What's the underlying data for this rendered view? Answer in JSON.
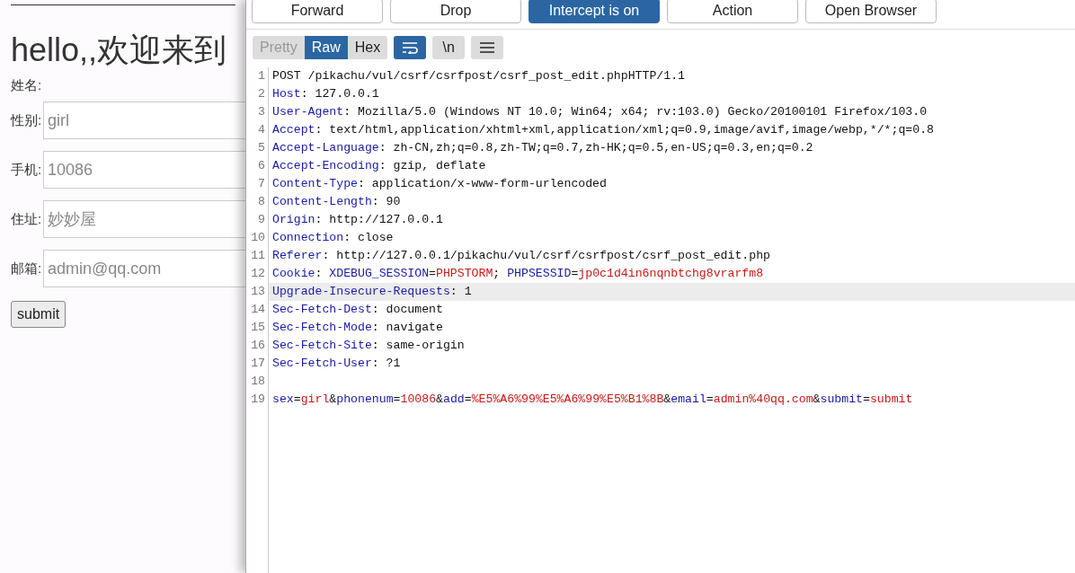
{
  "page": {
    "heading": "hello,,欢迎来到",
    "fields": [
      {
        "label": "姓名:",
        "kind": "text"
      },
      {
        "label": "性别:",
        "kind": "input",
        "placeholder": "girl"
      },
      {
        "label": "手机:",
        "kind": "input",
        "placeholder": "10086"
      },
      {
        "label": "住址:",
        "kind": "input",
        "placeholder": "妙妙屋"
      },
      {
        "label": "邮箱:",
        "kind": "input",
        "placeholder": "admin@qq.com"
      }
    ],
    "submit": "submit"
  },
  "proxy": {
    "actions": [
      {
        "label": "Forward",
        "selected": false
      },
      {
        "label": "Drop",
        "selected": false
      },
      {
        "label": "Intercept is on",
        "selected": true
      },
      {
        "label": "Action",
        "selected": false
      },
      {
        "label": "Open Browser",
        "selected": false
      }
    ],
    "view_tabs": [
      {
        "label": "Pretty",
        "selected": false,
        "disabled": true
      },
      {
        "label": "Raw",
        "selected": true,
        "disabled": false
      },
      {
        "label": "Hex",
        "selected": false,
        "disabled": false
      }
    ],
    "tools": [
      {
        "kind": "wrap",
        "selected": true
      },
      {
        "kind": "newline",
        "label": "\\n",
        "selected": false
      },
      {
        "kind": "menu",
        "selected": false
      }
    ],
    "lines": [
      {
        "number": "1",
        "highlighted": false,
        "parts": [
          {
            "text": "POST /pikachu/vul/csrf/csrfpost/csrf_post_edit.phpHTTP/1.1",
            "kind": "plain"
          }
        ]
      },
      {
        "number": "2",
        "highlighted": false,
        "parts": [
          {
            "text": "Host",
            "kind": "key"
          },
          {
            "text": ": 127.0.0.1",
            "kind": "plain"
          }
        ]
      },
      {
        "number": "3",
        "highlighted": false,
        "parts": [
          {
            "text": "User-Agent",
            "kind": "key"
          },
          {
            "text": ": Mozilla/5.0 (Windows NT 10.0; Win64; x64; rv:103.0) Gecko/20100101 Firefox/103.0",
            "kind": "plain"
          }
        ]
      },
      {
        "number": "4",
        "highlighted": false,
        "parts": [
          {
            "text": "Accept",
            "kind": "key"
          },
          {
            "text": ": text/html,application/xhtml+xml,application/xml;q=0.9,image/avif,image/webp,*/*;q=0.8",
            "kind": "plain"
          }
        ]
      },
      {
        "number": "5",
        "highlighted": false,
        "parts": [
          {
            "text": "Accept-Language",
            "kind": "key"
          },
          {
            "text": ": zh-CN,zh;q=0.8,zh-TW;q=0.7,zh-HK;q=0.5,en-US;q=0.3,en;q=0.2",
            "kind": "plain"
          }
        ]
      },
      {
        "number": "6",
        "highlighted": false,
        "parts": [
          {
            "text": "Accept-Encoding",
            "kind": "key"
          },
          {
            "text": ": gzip, deflate",
            "kind": "plain"
          }
        ]
      },
      {
        "number": "7",
        "highlighted": false,
        "parts": [
          {
            "text": "Content-Type",
            "kind": "key"
          },
          {
            "text": ": application/x-www-form-urlencoded",
            "kind": "plain"
          }
        ]
      },
      {
        "number": "8",
        "highlighted": false,
        "parts": [
          {
            "text": "Content-Length",
            "kind": "key"
          },
          {
            "text": ": 90",
            "kind": "plain"
          }
        ]
      },
      {
        "number": "9",
        "highlighted": false,
        "parts": [
          {
            "text": "Origin",
            "kind": "key"
          },
          {
            "text": ": http://127.0.0.1",
            "kind": "plain"
          }
        ]
      },
      {
        "number": "10",
        "highlighted": false,
        "parts": [
          {
            "text": "Connection",
            "kind": "key"
          },
          {
            "text": ": close",
            "kind": "plain"
          }
        ]
      },
      {
        "number": "11",
        "highlighted": false,
        "parts": [
          {
            "text": "Referer",
            "kind": "key"
          },
          {
            "text": ": http://127.0.0.1/pikachu/vul/csrf/csrfpost/csrf_post_edit.php",
            "kind": "plain"
          }
        ]
      },
      {
        "number": "12",
        "highlighted": false,
        "parts": [
          {
            "text": "Cookie",
            "kind": "key"
          },
          {
            "text": ": ",
            "kind": "plain"
          },
          {
            "text": "XDEBUG_SESSION",
            "kind": "key"
          },
          {
            "text": "=",
            "kind": "plain"
          },
          {
            "text": "PHPSTORM",
            "kind": "value"
          },
          {
            "text": "; ",
            "kind": "plain"
          },
          {
            "text": "PHPSESSID",
            "kind": "key"
          },
          {
            "text": "=",
            "kind": "plain"
          },
          {
            "text": "jp0c1d4in6nqnbtchg8vrarfm8",
            "kind": "value"
          }
        ]
      },
      {
        "number": "13",
        "highlighted": true,
        "parts": [
          {
            "text": "Upgrade-Insecure-Requests",
            "kind": "key"
          },
          {
            "text": ": 1",
            "kind": "plain"
          }
        ]
      },
      {
        "number": "14",
        "highlighted": false,
        "parts": [
          {
            "text": "Sec-Fetch-Dest",
            "kind": "key"
          },
          {
            "text": ": document",
            "kind": "plain"
          }
        ]
      },
      {
        "number": "15",
        "highlighted": false,
        "parts": [
          {
            "text": "Sec-Fetch-Mode",
            "kind": "key"
          },
          {
            "text": ": navigate",
            "kind": "plain"
          }
        ]
      },
      {
        "number": "16",
        "highlighted": false,
        "parts": [
          {
            "text": "Sec-Fetch-Site",
            "kind": "key"
          },
          {
            "text": ": same-origin",
            "kind": "plain"
          }
        ]
      },
      {
        "number": "17",
        "highlighted": false,
        "parts": [
          {
            "text": "Sec-Fetch-User",
            "kind": "key"
          },
          {
            "text": ": ?1",
            "kind": "plain"
          }
        ]
      },
      {
        "number": "18",
        "highlighted": false
      },
      {
        "number": "19",
        "highlighted": false,
        "parts": [
          {
            "text": "sex",
            "kind": "key"
          },
          {
            "text": "=",
            "kind": "plain"
          },
          {
            "text": "girl",
            "kind": "value"
          },
          {
            "text": "&",
            "kind": "plain"
          },
          {
            "text": "phonenum",
            "kind": "key"
          },
          {
            "text": "=",
            "kind": "plain"
          },
          {
            "text": "10086",
            "kind": "value"
          },
          {
            "text": "&",
            "kind": "plain"
          },
          {
            "text": "add",
            "kind": "key"
          },
          {
            "text": "=",
            "kind": "plain"
          },
          {
            "text": "%E5%A6%99%E5%A6%99%E5%B1%8B",
            "kind": "value"
          },
          {
            "text": "&",
            "kind": "plain"
          },
          {
            "text": "email",
            "kind": "key"
          },
          {
            "text": "=",
            "kind": "plain"
          },
          {
            "text": "admin%40qq.com",
            "kind": "value"
          },
          {
            "text": "&",
            "kind": "plain"
          },
          {
            "text": "submit",
            "kind": "key"
          },
          {
            "text": "=",
            "kind": "plain"
          },
          {
            "text": "submit",
            "kind": "value"
          }
        ]
      }
    ]
  }
}
